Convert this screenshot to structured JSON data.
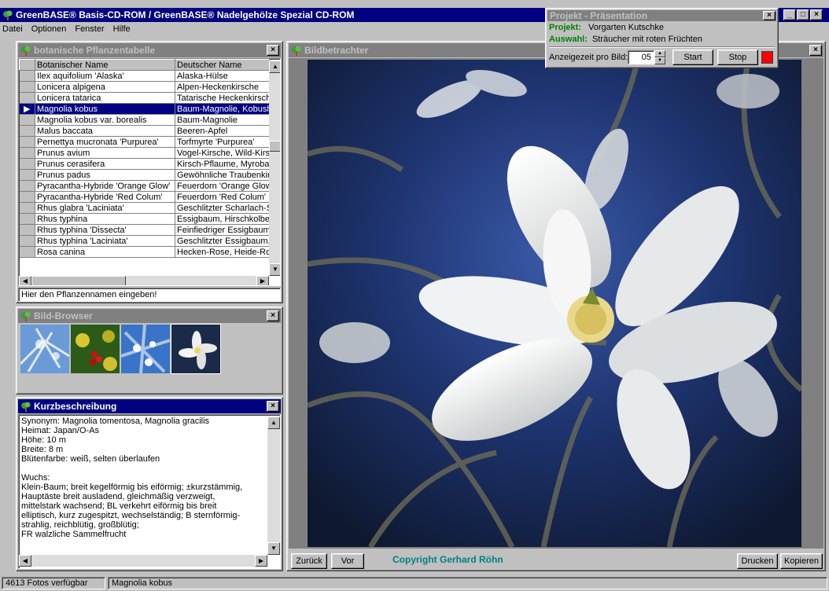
{
  "app": {
    "title": "GreenBASE® Basis-CD-ROM / GreenBASE® Nadelgehölze Spezial CD-ROM"
  },
  "menu": [
    "Datei",
    "Optionen",
    "Fenster",
    "Hilfe"
  ],
  "plant_table": {
    "title": "botanische Pflanzentabelle",
    "columns": [
      "Botanischer Name",
      "Deutscher Name"
    ],
    "rows": [
      [
        "Ilex aquifolium 'Alaska'",
        "Alaska-Hülse"
      ],
      [
        "Lonicera alpigena",
        "Alpen-Heckenkirsche"
      ],
      [
        "Lonicera tatarica",
        "Tatarische Heckenkirsch"
      ],
      [
        "Magnolia kobus",
        "Baum-Magnolie, Kobushi"
      ],
      [
        "Magnolia kobus var. borealis",
        "Baum-Magnolie"
      ],
      [
        "Malus baccata",
        "Beeren-Apfel"
      ],
      [
        "Pernettya mucronata 'Purpurea'",
        "Torfmyrte 'Purpurea'"
      ],
      [
        "Prunus avium",
        "Vogel-Kirsche, Wild-Kirsc"
      ],
      [
        "Prunus cerasifera",
        "Kirsch-Pflaume, Myrobala"
      ],
      [
        "Prunus padus",
        "Gewöhnliche Traubenkir"
      ],
      [
        "Pyracantha-Hybride 'Orange Glow'",
        "Feuerdorn 'Orange Glow'"
      ],
      [
        "Pyracantha-Hybride 'Red Colum'",
        "Feuerdorn 'Red Colum'"
      ],
      [
        "Rhus glabra 'Laciniata'",
        "Geschlitzter Scharlach-S"
      ],
      [
        "Rhus typhina",
        "Essigbaum, Hirschkolber"
      ],
      [
        "Rhus typhina 'Dissecta'",
        "Feinfiedriger Essigbaum,"
      ],
      [
        "Rhus typhina 'Laciniata'",
        "Geschlitzter Essigbaum, |"
      ],
      [
        "Rosa canina",
        "Hecken-Rose, Heide-Ro"
      ]
    ],
    "selected_index": 3,
    "search_placeholder": "Hier den Pflanzennamen eingeben!"
  },
  "browser": {
    "title": "Bild-Browser",
    "thumbs": [
      "blue-sky-branches",
      "red-berries",
      "white-blossom-branches",
      "magnolia-flower"
    ]
  },
  "description": {
    "title": "Kurzbeschreibung",
    "text": "Synonym: Magnolia tomentosa, Magnolia gracilis\nHeimat: Japan/O-As\nHöhe: 10 m\nBreite: 8 m\nBlütenfarbe: weiß, selten überlaufen\n\nWuchs:\nKlein-Baum; breit kegelförmig bis eiförmig; ±kurzstämmig,\nHauptäste breit ausladend, gleichmäßig verzweigt,\nmittelstark wachsend; BL verkehrt eiförmig bis breit\nelliptisch, kurz zugespitzt, wechselständig; B sternförmig-\nstrahlig, reichblütig, großblütig;\nFR walzliche Sammelfrucht"
  },
  "viewer": {
    "title": "Bildbetrachter",
    "back": "Zurück",
    "forward": "Vor",
    "copyright": "Copyright Gerhard Röhn",
    "print": "Drucken",
    "copy": "Kopieren"
  },
  "presentation": {
    "title": "Projekt - Präsentation",
    "project_label": "Projekt:",
    "project_value": "Vorgarten Kutschke",
    "selection_label": "Auswahl:",
    "selection_value": "Sträucher mit roten Früchten",
    "time_label": "Anzeigezeit pro Bild:",
    "time_value": "05",
    "start": "Start",
    "stop": "Stop"
  },
  "status": {
    "photos": "4613 Fotos verfügbar",
    "current": "Magnolia kobus"
  },
  "colors": {
    "active_title": "#000080",
    "inactive_title": "#808080",
    "label_green": "#008000",
    "copyright": "#008080",
    "stop_indicator": "#ff0000"
  }
}
